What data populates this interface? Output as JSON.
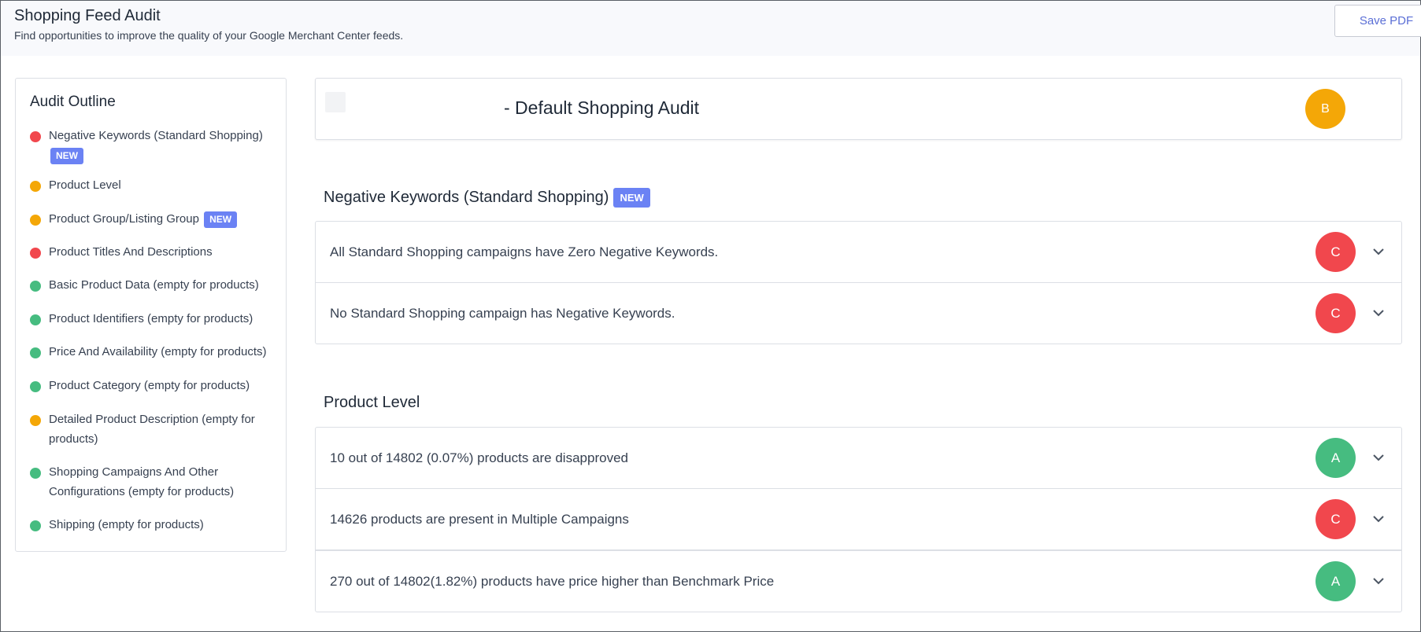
{
  "header": {
    "title": "Shopping Feed Audit",
    "subtitle": "Find opportunities to improve the quality of your Google Merchant Center feeds.",
    "save_label": "Save PDF"
  },
  "outline": {
    "title": "Audit Outline",
    "new_label": "NEW",
    "items": [
      {
        "label": "Negative Keywords (Standard Shopping)",
        "status": "red",
        "new": true
      },
      {
        "label": "Product Level",
        "status": "orange",
        "new": false
      },
      {
        "label": "Product Group/Listing Group",
        "status": "orange",
        "new": true
      },
      {
        "label": "Product Titles And Descriptions",
        "status": "red",
        "new": false
      },
      {
        "label": "Basic Product Data (empty for products)",
        "status": "green",
        "new": false
      },
      {
        "label": "Product Identifiers (empty for products)",
        "status": "green",
        "new": false
      },
      {
        "label": "Price And Availability (empty for products)",
        "status": "green",
        "new": false
      },
      {
        "label": "Product Category (empty for products)",
        "status": "green",
        "new": false
      },
      {
        "label": "Detailed Product Description (empty for products)",
        "status": "orange",
        "new": false
      },
      {
        "label": "Shopping Campaigns And Other Configurations (empty for products)",
        "status": "green",
        "new": false
      },
      {
        "label": "Shipping (empty for products)",
        "status": "green",
        "new": false
      }
    ]
  },
  "audit": {
    "title": "- Default Shopping Audit",
    "grade": "B"
  },
  "sections": [
    {
      "title": "Negative Keywords (Standard Shopping)",
      "new": true,
      "rows": [
        {
          "text": "All Standard Shopping campaigns have Zero Negative Keywords.",
          "grade": "C"
        },
        {
          "text": "No Standard Shopping campaign has Negative Keywords.",
          "grade": "C"
        }
      ]
    },
    {
      "title": "Product Level",
      "new": false,
      "rows": [
        {
          "text": "10 out of 14802 (0.07%) products are disapproved",
          "grade": "A"
        },
        {
          "text": "14626 products are present in Multiple Campaigns",
          "grade": "C"
        },
        {
          "text": "270 out of 14802(1.82%) products have price higher than Benchmark Price",
          "grade": "A"
        }
      ]
    }
  ],
  "colors": {
    "red": "#f1474d",
    "orange": "#f4a707",
    "green": "#46bc80",
    "accent": "#6b82f4"
  }
}
